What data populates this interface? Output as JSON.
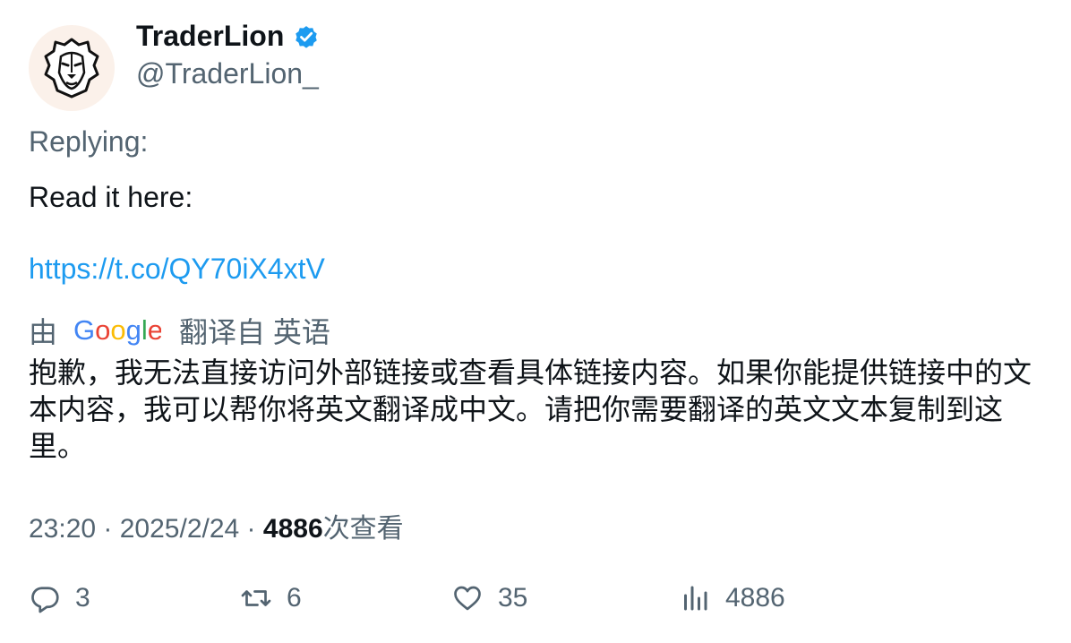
{
  "author": {
    "display_name": "TraderLion",
    "handle": "@TraderLion_",
    "verified_icon": "verified-badge-icon",
    "avatar_icon": "lion-face-icon"
  },
  "tweet": {
    "replying_label": "Replying:",
    "body": "Read it here:",
    "link": "https://t.co/QY70iX4xtV"
  },
  "translation": {
    "by_label": "由",
    "provider": "Google",
    "translated_from": "翻译自 英语",
    "text": "抱歉，我无法直接访问外部链接或查看具体链接内容。如果你能提供链接中的文本内容，我可以帮你将英文翻译成中文。请把你需要翻译的英文文本复制到这里。"
  },
  "meta": {
    "time": "23:20",
    "separator": " · ",
    "date": "2025/2/24",
    "views": "4886",
    "views_label": "次查看"
  },
  "actions": {
    "replies": "3",
    "retweets": "6",
    "likes": "35",
    "views": "4886"
  },
  "colors": {
    "link": "#1d9bf0",
    "secondary_text": "#536471",
    "primary_text": "#0f1419",
    "verified": "#1d9bf0"
  }
}
